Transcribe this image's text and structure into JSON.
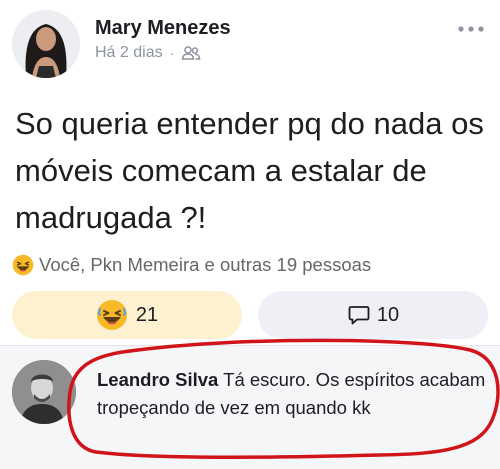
{
  "post": {
    "author": "Mary Menezes",
    "time": "Há 2 dias",
    "separator": "·",
    "audience_icon": "friends-icon",
    "text": "So queria entender pq do nada os móveis comecam a estalar de madrugada ?!"
  },
  "reactions": {
    "emoji": "laughing-emoji",
    "summary": "Você, Pkn Memeira e outras 19 pessoas",
    "reaction_count": "21",
    "comment_count": "10"
  },
  "comment": {
    "author": "Leandro Silva",
    "text": "Tá escuro. Os espíritos acabam tropeçando de vez em quando kk"
  },
  "colors": {
    "reaction_button_bg": "#fdf1cf",
    "comment_button_bg": "#eef0f6",
    "highlight_oval": "#d0141a",
    "secondary_text": "#8d949e"
  }
}
